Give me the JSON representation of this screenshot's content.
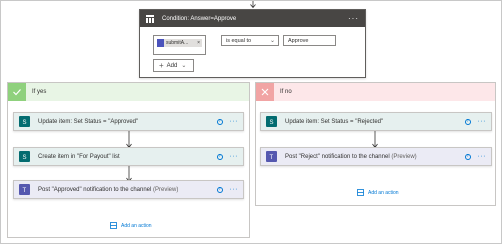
{
  "condition": {
    "title": "Condition: Answer=Approve",
    "token_label": "submitA...",
    "token_close": "×",
    "operator": "is equal to",
    "value": "Approve",
    "add_label": "Add"
  },
  "yes_branch": {
    "title": "If yes",
    "actions": [
      {
        "title": "Update item: Set Status = \"Approved\"",
        "icon": "sharepoint-icon"
      },
      {
        "title": "Create item in \"For Payout\" list",
        "icon": "sharepoint-icon"
      },
      {
        "title": "Post \"Approved\" notification to the channel",
        "preview": "(Preview)",
        "icon": "teams-icon"
      }
    ],
    "add_action": "Add an action"
  },
  "no_branch": {
    "title": "If no",
    "actions": [
      {
        "title": "Update item: Set Status = \"Rejected\"",
        "icon": "sharepoint-icon"
      },
      {
        "title": "Post \"Reject\" notification to the channel",
        "preview": "(Preview)",
        "icon": "teams-icon"
      }
    ],
    "add_action": "Add an action"
  },
  "glyphs": {
    "more": "···",
    "help": "?",
    "chevron": "⌄",
    "plus": "+"
  },
  "colors": {
    "condition_header": "#484644",
    "yes_header": "#e8f5e5",
    "yes_icon": "#8fd17d",
    "no_header": "#fde7e9",
    "no_icon": "#f1a4a4",
    "sharepoint": "#036c70",
    "teams": "#5558af",
    "link": "#0078d4"
  }
}
